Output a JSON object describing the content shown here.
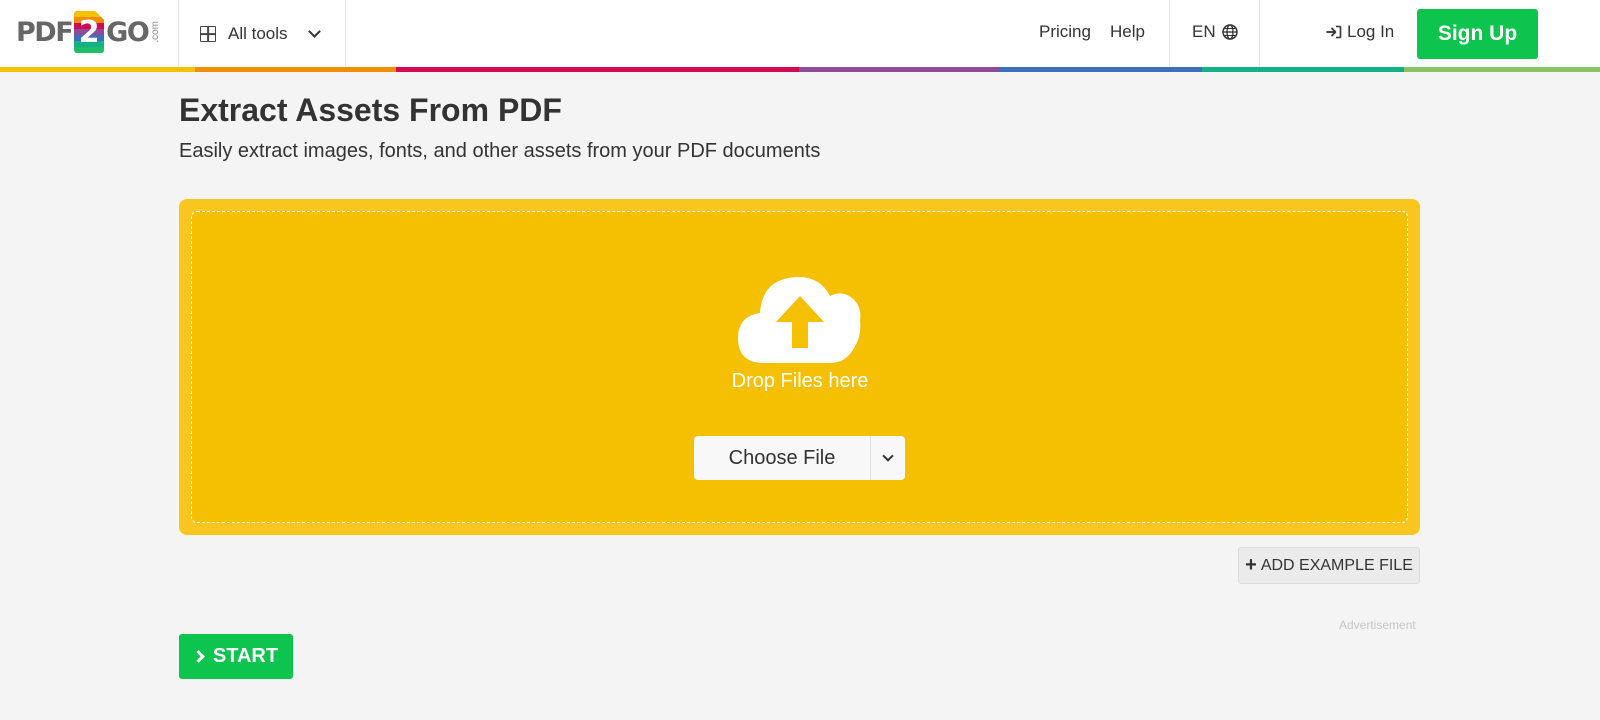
{
  "header": {
    "logo": {
      "pdf": "PDF",
      "two": "2",
      "go": "GO",
      "com": ".com"
    },
    "all_tools_label": "All tools",
    "nav": {
      "pricing": "Pricing",
      "help": "Help"
    },
    "language": "EN",
    "login_label": "Log In",
    "signup_label": "Sign Up",
    "color_bar": [
      "#f5c002",
      "#f08c00",
      "#d10a52",
      "#8f4b9b",
      "#3a70bd",
      "#14b086",
      "#8cc263"
    ],
    "logo_stripes": [
      "#f5c002",
      "#f08c00",
      "#d10a52",
      "#8f4b9b",
      "#3a70bd",
      "#14b086",
      "#1fbf6a"
    ]
  },
  "main": {
    "title": "Extract Assets From PDF",
    "subtitle": "Easily extract images, fonts, and other assets from your PDF documents",
    "dropzone": {
      "icon": "cloud-upload-icon",
      "text": "Drop Files here",
      "choose_label": "Choose File"
    },
    "add_example_label": "ADD EXAMPLE FILE",
    "advertisement_label": "Advertisement",
    "start_label": "START"
  },
  "colors": {
    "accent_green": "#0cc44e",
    "dropzone_yellow": "#f5c002"
  }
}
